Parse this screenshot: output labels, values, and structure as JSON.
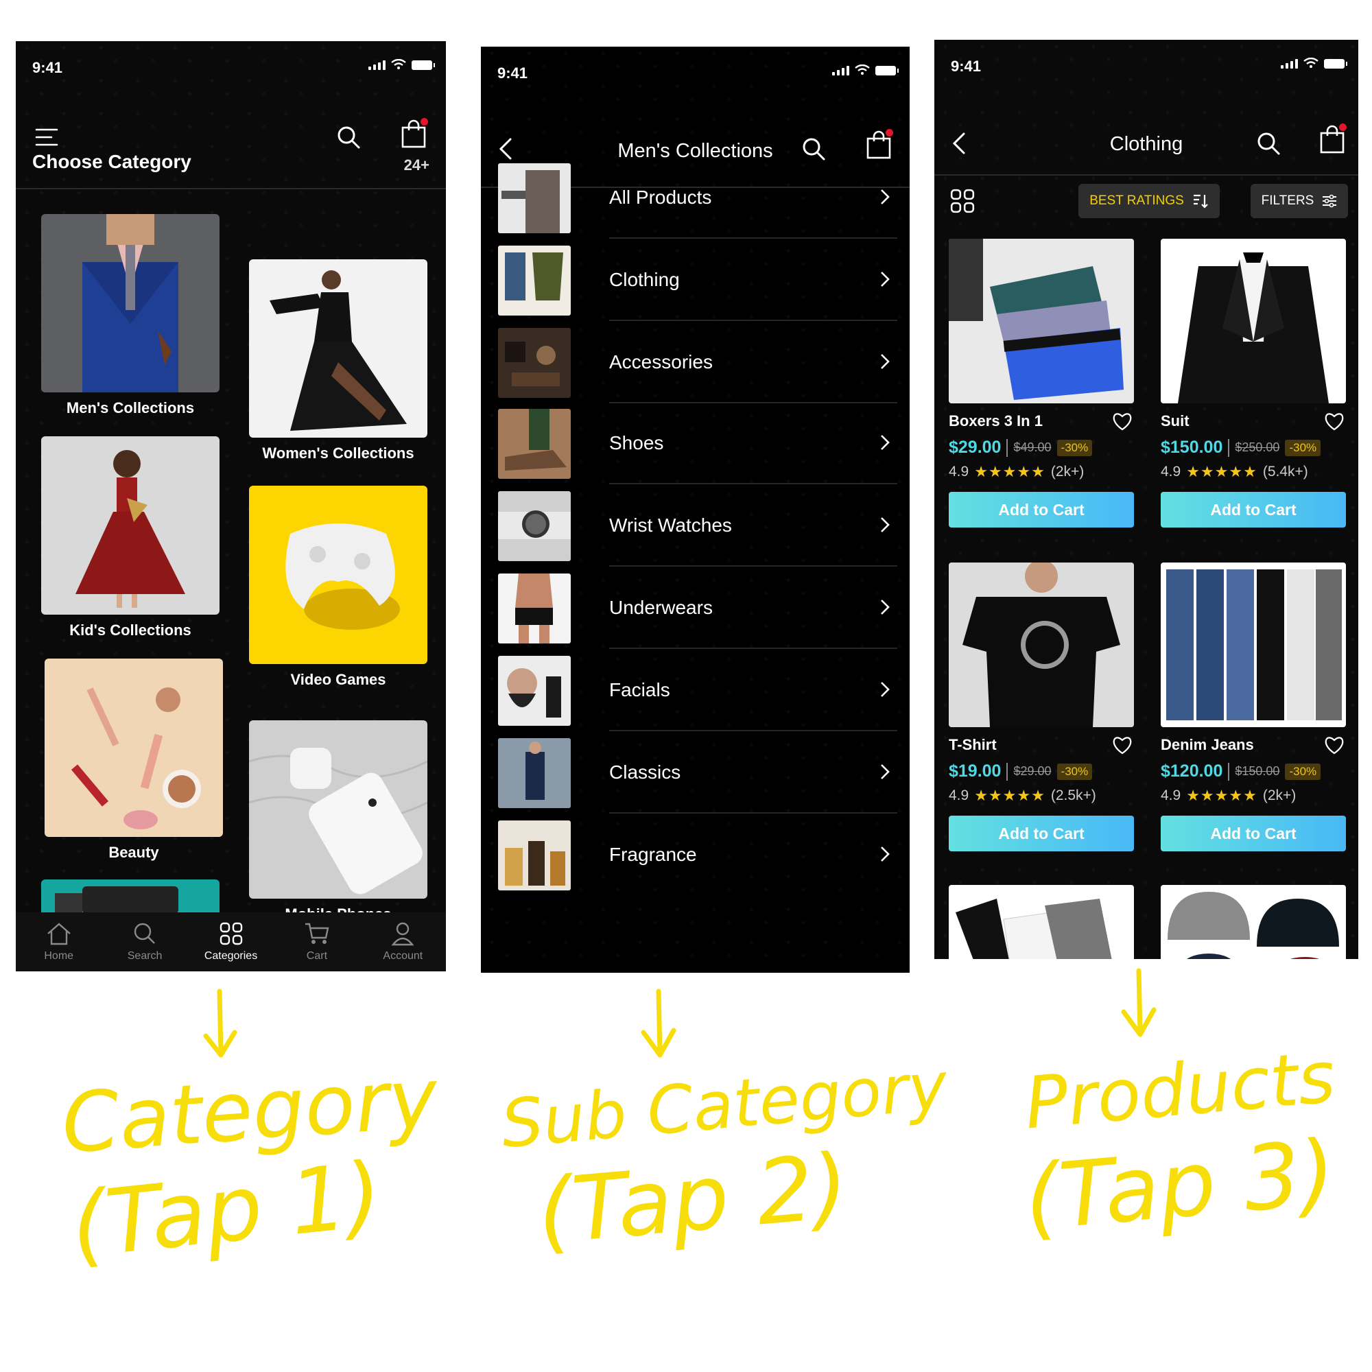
{
  "status_time": "9:41",
  "screen1": {
    "title": "Choose Category",
    "count": "24+",
    "categories": [
      {
        "label": "Men's Collections"
      },
      {
        "label": "Women's Collections"
      },
      {
        "label": "Kid's Collections"
      },
      {
        "label": "Video Games"
      },
      {
        "label": "Beauty"
      },
      {
        "label": "Mobile Phones"
      }
    ],
    "tabs": [
      {
        "label": "Home",
        "icon": "home-icon"
      },
      {
        "label": "Search",
        "icon": "search-icon"
      },
      {
        "label": "Categories",
        "icon": "grid-icon"
      },
      {
        "label": "Cart",
        "icon": "cart-icon"
      },
      {
        "label": "Account",
        "icon": "user-icon"
      }
    ]
  },
  "screen2": {
    "title": "Men's Collections",
    "items": [
      {
        "label": "All Products"
      },
      {
        "label": "Clothing"
      },
      {
        "label": "Accessories"
      },
      {
        "label": "Shoes"
      },
      {
        "label": "Wrist Watches"
      },
      {
        "label": "Underwears"
      },
      {
        "label": "Facials"
      },
      {
        "label": "Classics"
      },
      {
        "label": "Fragrance"
      }
    ]
  },
  "screen3": {
    "title": "Clothing",
    "sort_label": "BEST RATINGS",
    "filter_label": "FILTERS",
    "add_to_cart": "Add to Cart",
    "products": [
      {
        "name": "Boxers 3 In 1",
        "price": "$29.00",
        "old_price": "$49.00",
        "discount": "-30%",
        "rating": "4.9",
        "reviews": "(2k+)"
      },
      {
        "name": "Suit",
        "price": "$150.00",
        "old_price": "$250.00",
        "discount": "-30%",
        "rating": "4.9",
        "reviews": "(5.4k+)"
      },
      {
        "name": "T-Shirt",
        "price": "$19.00",
        "old_price": "$29.00",
        "discount": "-30%",
        "rating": "4.9",
        "reviews": "(2.5k+)"
      },
      {
        "name": "Denim Jeans",
        "price": "$120.00",
        "old_price": "$150.00",
        "discount": "-30%",
        "rating": "4.9",
        "reviews": "(2k+)"
      }
    ]
  },
  "annotations": {
    "a1_line1": "Category",
    "a1_line2": "(Tap 1)",
    "a2_line1": "Sub Category",
    "a2_line2": "(Tap 2)",
    "a3_line1": "Products",
    "a3_line2": "(Tap 3)"
  },
  "colors": {
    "accent_price": "#4ed9e6",
    "annotation": "#f7dd0a",
    "cart_badge": "#e3162c",
    "sort_text": "#f5d000"
  }
}
